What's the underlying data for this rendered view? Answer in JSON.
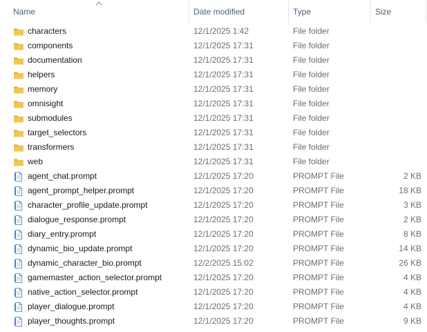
{
  "columns": {
    "name": "Name",
    "date_modified": "Date modified",
    "type": "Type",
    "size": "Size"
  },
  "icons": {
    "folder": "folder-icon",
    "file": "prompt-file-icon",
    "sort": "sort-ascending-icon"
  },
  "colors": {
    "folder_front": "#f3c74e",
    "folder_back": "#dcaa34",
    "header_text": "#4c607a",
    "meta_text": "#6d6d6d",
    "file_icon_border": "#6b8fc6"
  },
  "files": [
    {
      "name": "characters",
      "date": "12/1/2025 1:42",
      "type": "File folder",
      "size": "",
      "kind": "folder"
    },
    {
      "name": "components",
      "date": "12/1/2025 17:31",
      "type": "File folder",
      "size": "",
      "kind": "folder"
    },
    {
      "name": "documentation",
      "date": "12/1/2025 17:31",
      "type": "File folder",
      "size": "",
      "kind": "folder"
    },
    {
      "name": "helpers",
      "date": "12/1/2025 17:31",
      "type": "File folder",
      "size": "",
      "kind": "folder"
    },
    {
      "name": "memory",
      "date": "12/1/2025 17:31",
      "type": "File folder",
      "size": "",
      "kind": "folder"
    },
    {
      "name": "omnisight",
      "date": "12/1/2025 17:31",
      "type": "File folder",
      "size": "",
      "kind": "folder"
    },
    {
      "name": "submodules",
      "date": "12/1/2025 17:31",
      "type": "File folder",
      "size": "",
      "kind": "folder"
    },
    {
      "name": "target_selectors",
      "date": "12/1/2025 17:31",
      "type": "File folder",
      "size": "",
      "kind": "folder"
    },
    {
      "name": "transformers",
      "date": "12/1/2025 17:31",
      "type": "File folder",
      "size": "",
      "kind": "folder"
    },
    {
      "name": "web",
      "date": "12/1/2025 17:31",
      "type": "File folder",
      "size": "",
      "kind": "folder"
    },
    {
      "name": "agent_chat.prompt",
      "date": "12/1/2025 17:20",
      "type": "PROMPT File",
      "size": "2 KB",
      "kind": "file"
    },
    {
      "name": "agent_prompt_helper.prompt",
      "date": "12/1/2025 17:20",
      "type": "PROMPT File",
      "size": "18 KB",
      "kind": "file"
    },
    {
      "name": "character_profile_update.prompt",
      "date": "12/1/2025 17:20",
      "type": "PROMPT File",
      "size": "3 KB",
      "kind": "file"
    },
    {
      "name": "dialogue_response.prompt",
      "date": "12/1/2025 17:20",
      "type": "PROMPT File",
      "size": "2 KB",
      "kind": "file"
    },
    {
      "name": "diary_entry.prompt",
      "date": "12/1/2025 17:20",
      "type": "PROMPT File",
      "size": "8 KB",
      "kind": "file"
    },
    {
      "name": "dynamic_bio_update.prompt",
      "date": "12/1/2025 17:20",
      "type": "PROMPT File",
      "size": "14 KB",
      "kind": "file"
    },
    {
      "name": "dynamic_character_bio.prompt",
      "date": "12/2/2025 15:02",
      "type": "PROMPT File",
      "size": "26 KB",
      "kind": "file"
    },
    {
      "name": "gamemaster_action_selector.prompt",
      "date": "12/1/2025 17:20",
      "type": "PROMPT File",
      "size": "4 KB",
      "kind": "file"
    },
    {
      "name": "native_action_selector.prompt",
      "date": "12/1/2025 17:20",
      "type": "PROMPT File",
      "size": "4 KB",
      "kind": "file"
    },
    {
      "name": "player_dialogue.prompt",
      "date": "12/1/2025 17:20",
      "type": "PROMPT File",
      "size": "4 KB",
      "kind": "file"
    },
    {
      "name": "player_thoughts.prompt",
      "date": "12/1/2025 17:20",
      "type": "PROMPT File",
      "size": "9 KB",
      "kind": "file"
    }
  ]
}
